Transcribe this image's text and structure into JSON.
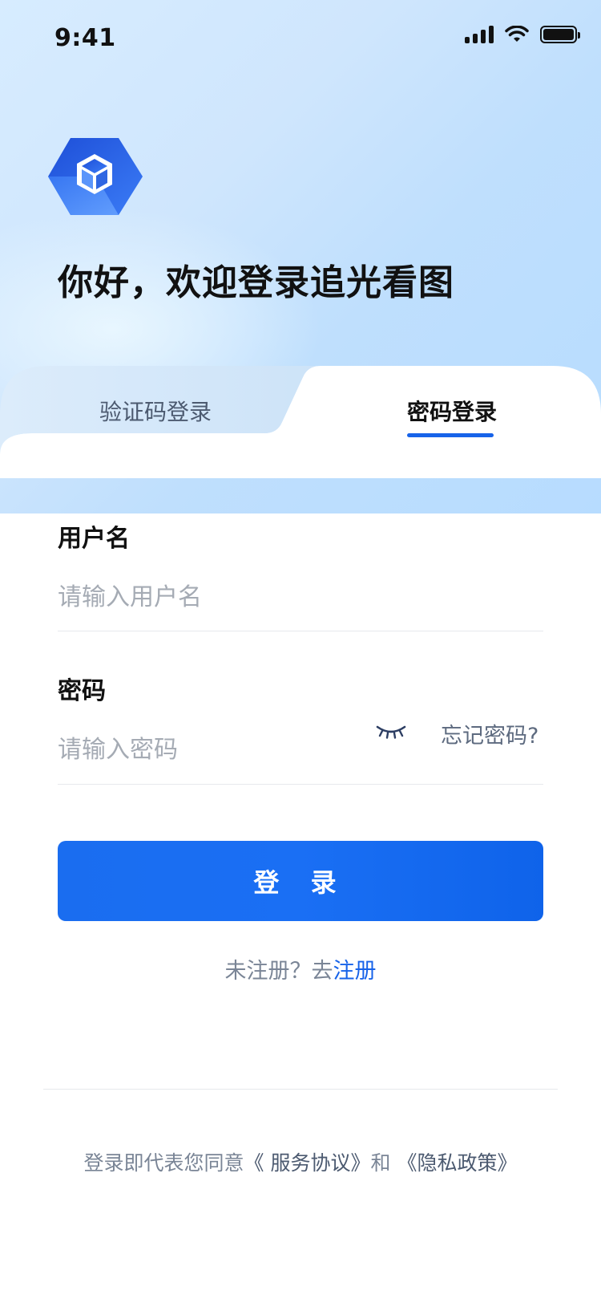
{
  "status_bar": {
    "time": "9:41"
  },
  "welcome": {
    "title": "你好，欢迎登录追光看图"
  },
  "tabs": [
    {
      "label": "验证码登录",
      "active": false
    },
    {
      "label": "密码登录",
      "active": true
    }
  ],
  "form": {
    "username": {
      "label": "用户名",
      "placeholder": "请输入用户名",
      "value": ""
    },
    "password": {
      "label": "密码",
      "placeholder": "请输入密码",
      "value": "",
      "toggle_icon": "eye-closed-icon"
    },
    "forgot_label": "忘记密码?",
    "login_label": "登 录",
    "register_prefix": "未注册？去",
    "register_link": "注册"
  },
  "footer": {
    "agreement_prefix": "登录即代表您同意",
    "service_link": "《 服务协议》",
    "and": "和",
    "privacy_link": "《隐私政策》"
  },
  "colors": {
    "primary": "#1763e9",
    "text_dark": "#111111",
    "text_muted": "#7a8596"
  }
}
